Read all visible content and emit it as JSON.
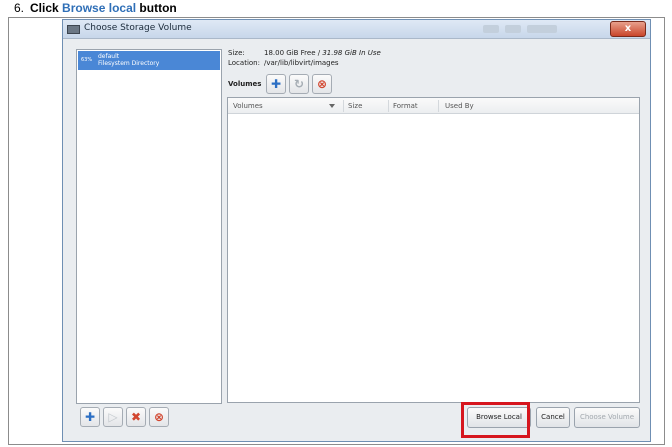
{
  "instruction": {
    "number": "6.",
    "prefix": "Click",
    "target": "Browse local",
    "suffix": "button"
  },
  "window": {
    "title": "Choose Storage Volume",
    "close_label": "x"
  },
  "pools": [
    {
      "percent": "63%",
      "name": "default",
      "type": "Filesystem Directory",
      "selected": true
    }
  ],
  "info": {
    "size_label": "Size:",
    "size_free": "18.00 GiB Free /",
    "size_used": "31.98 GiB In Use",
    "location_label": "Location:",
    "location_value": "/var/lib/libvirt/images"
  },
  "volumes_toolbar": {
    "label": "Volumes",
    "add_icon": "plus-icon",
    "refresh_icon": "refresh-icon",
    "delete_icon": "stop-icon"
  },
  "volume_table": {
    "columns": [
      "Volumes",
      "Size",
      "Format",
      "Used By"
    ],
    "rows": []
  },
  "pool_toolbar": {
    "icons": [
      "plus-icon",
      "play-icon",
      "delete-x-icon",
      "stop-icon"
    ]
  },
  "buttons": {
    "browse_local": "Browse Local",
    "cancel": "Cancel",
    "choose_volume": "Choose Volume"
  },
  "colors": {
    "selection": "#4a87d6",
    "highlight_box": "#d6161e",
    "instruction_accent": "#2f6fb7"
  }
}
